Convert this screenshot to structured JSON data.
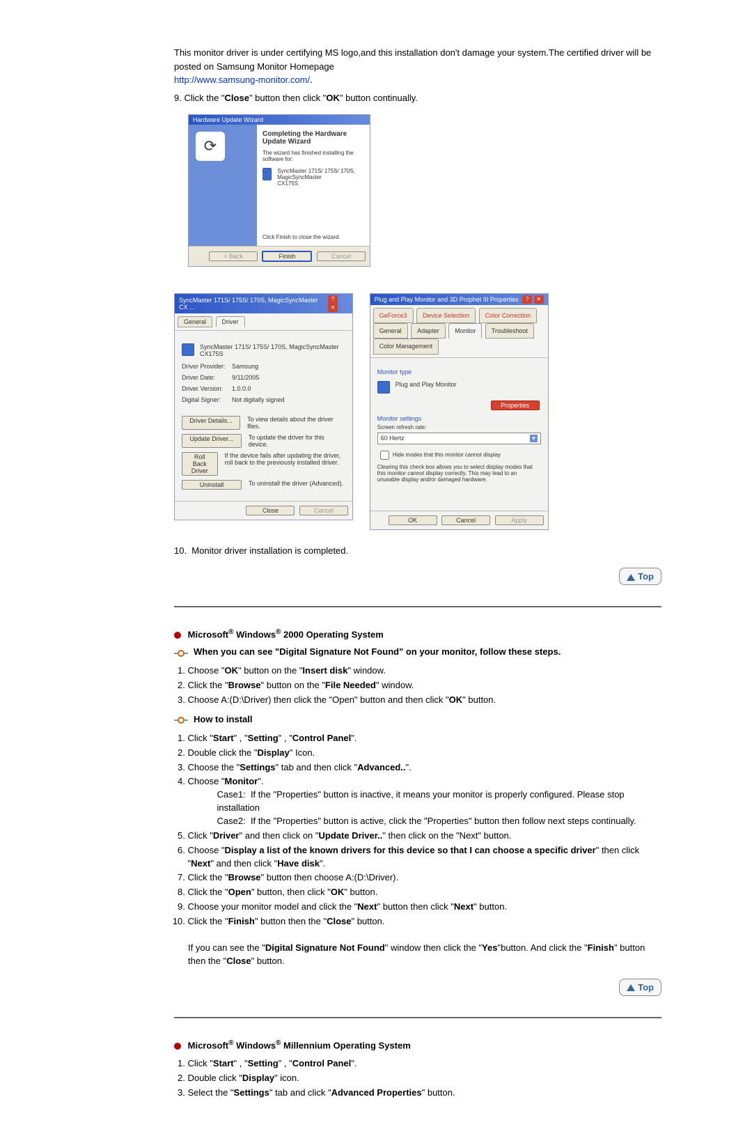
{
  "intro": {
    "para": "This monitor driver is under certifying MS logo,and this installation don't damage your system.The certified driver will be posted on Samsung Monitor Homepage",
    "link": "http://www.samsung-monitor.com/"
  },
  "step9": {
    "prefix": "9.",
    "text": "Click the \"",
    "close": "Close",
    "mid": "\" button then click \"",
    "ok": "OK",
    "end": "\" button continually."
  },
  "wizard_shot": {
    "title_bar": "Hardware Update Wizard",
    "heading": "Completing the Hardware Update Wizard",
    "line1": "The wizard has finished installing the software for:",
    "device": "SyncMaster 171S/ 175S/ 170S, MagicSyncMaster\nCX175S",
    "line2": "Click Finish to close the wizard.",
    "buttons": {
      "back": "< Back",
      "finish": "Finish",
      "cancel": "Cancel"
    }
  },
  "driver_shot": {
    "title_bar": "SyncMaster 171S/ 175S/ 170S, MagicSyncMaster CX ...",
    "tabs": {
      "general": "General",
      "driver": "Driver"
    },
    "device_name": "SyncMaster 171S/ 175S/ 170S, MagicSyncMaster\nCX175S",
    "rows": {
      "provider": {
        "label": "Driver Provider:",
        "value": "Samsung"
      },
      "date": {
        "label": "Driver Date:",
        "value": "9/11/2005"
      },
      "version": {
        "label": "Driver Version:",
        "value": "1.0.0.0"
      },
      "signer": {
        "label": "Digital Signer:",
        "value": "Not digitally signed"
      }
    },
    "buttons": {
      "details": {
        "label": "Driver Details...",
        "desc": "To view details about the driver files."
      },
      "update": {
        "label": "Update Driver...",
        "desc": "To update the driver for this device."
      },
      "rollback": {
        "label": "Roll Back Driver",
        "desc": "If the device fails after updating the driver, roll back to the previously installed driver."
      },
      "uninstall": {
        "label": "Uninstall",
        "desc": "To uninstall the driver (Advanced)."
      }
    },
    "footer": {
      "close": "Close",
      "cancel": "Cancel"
    }
  },
  "pnp_shot": {
    "title_bar": "Plug and Play Monitor and 3D Prophet III Properties",
    "tabs": {
      "geforce": "GeForce3",
      "device_sel": "Device Selection",
      "color_corr": "Color Correction",
      "general": "General",
      "adapter": "Adapter",
      "monitor": "Monitor",
      "troubleshoot": "Troubleshoot",
      "color_mgmt": "Color Management"
    },
    "monitor_type_label": "Monitor type",
    "monitor_type": "Plug and Play Monitor",
    "properties_btn": "Properties",
    "monitor_settings_label": "Monitor settings",
    "refresh_label": "Screen refresh rate:",
    "refresh_value": "60 Hertz",
    "checkbox": "Hide modes that this monitor cannot display",
    "checkbox_desc": "Clearing this check box allows you to select display modes that this monitor cannot display correctly. This may lead to an unusable display and/or damaged hardware.",
    "footer": {
      "ok": "OK",
      "cancel": "Cancel",
      "apply": "Apply"
    }
  },
  "step10": "Monitor driver installation is completed.",
  "top_label": "Top",
  "w2000": {
    "heading_pre": "Microsoft",
    "reg": "®",
    "heading_mid": " Windows",
    "heading_end": " 2000 Operating System",
    "sub1": "When you can see \"Digital Signature Not Found\" on your monitor, follow these steps.",
    "ol1": [
      {
        "p": "Choose \"",
        "b": "OK",
        "m": "\" button on the \"",
        "b2": "Insert disk",
        "s": "\" window."
      },
      {
        "p": "Click the \"",
        "b": "Browse",
        "m": "\" button on the \"",
        "b2": "File Needed",
        "s": "\" window."
      },
      {
        "p": "Choose A:(D:\\Driver) then click the \"Open\" button and then click \"",
        "b": "OK",
        "s": "\" button."
      }
    ],
    "sub2": "How to install",
    "ol2": [
      {
        "p": "Click \"",
        "b": "Start",
        "m1": "\" , \"",
        "b2": "Setting",
        "m2": "\" , \"",
        "b3": "Control Panel",
        "s": "\"."
      },
      {
        "p": "Double click the \"",
        "b": "Display",
        "s": "\" Icon."
      },
      {
        "p": "Choose the \"",
        "b": "Settings",
        "m": "\" tab and then click \"",
        "b2": "Advanced..",
        "s": "\"."
      },
      {
        "p": "Choose \"",
        "b": "Monitor",
        "s": "\"."
      },
      {
        "case1_label": "Case1:",
        "case1": "If the \"Properties\" button is inactive, it means your monitor is properly configured. Please stop installation",
        "case2_label": "Case2:",
        "case2": "If the \"Properties\" button is active, click the \"Properties\" button then follow next steps continually."
      },
      {
        "p": "Click \"",
        "b": "Driver",
        "m": "\" and then click on \"",
        "b2": "Update Driver..",
        "s": "\" then click on the \"Next\" button."
      },
      {
        "p": "Choose \"",
        "b": "Display a list of the known drivers for this device so that I can choose a specific driver",
        "m": "\" then click \"",
        "b2": "Next",
        "m2": "\" and then click \"",
        "b3": "Have disk",
        "s": "\"."
      },
      {
        "p": "Click the \"",
        "b": "Browse",
        "s": "\" button then choose A:(D:\\Driver)."
      },
      {
        "p": "Click the \"",
        "b": "Open",
        "m": "\" button, then click \"",
        "b2": "OK",
        "s": "\" button."
      },
      {
        "p": "Choose your monitor model and click the \"",
        "b": "Next",
        "m": "\" button then click \"",
        "b2": "Next",
        "s": "\" button."
      },
      {
        "p": "Click the \"",
        "b": "Finish",
        "m": "\" button then the \"",
        "b2": "Close",
        "s": "\" button."
      }
    ],
    "trailer1a": "If you can see the \"",
    "trailer1b": "Digital Signature Not Found",
    "trailer1c": "\" window then click the \"",
    "trailer1d": "Yes",
    "trailer1e": "\"button. And click the \"",
    "trailer1f": "Finish",
    "trailer1g": "\" button then the \"",
    "trailer1h": "Close",
    "trailer1i": "\" button."
  },
  "wme": {
    "heading_pre": "Microsoft",
    "reg": "®",
    "heading_mid": " Windows",
    "heading_end": " Millennium Operating System",
    "ol": [
      {
        "p": "Click \"",
        "b": "Start",
        "m1": "\" , \"",
        "b2": "Setting",
        "m2": "\" , \"",
        "b3": "Control Panel",
        "s": "\"."
      },
      {
        "p": "Double click \"",
        "b": "Display",
        "s": "\" icon."
      },
      {
        "p": "Select the \"",
        "b": "Settings",
        "m": "\" tab and click \"",
        "b2": "Advanced Properties",
        "s": "\" button."
      }
    ]
  }
}
